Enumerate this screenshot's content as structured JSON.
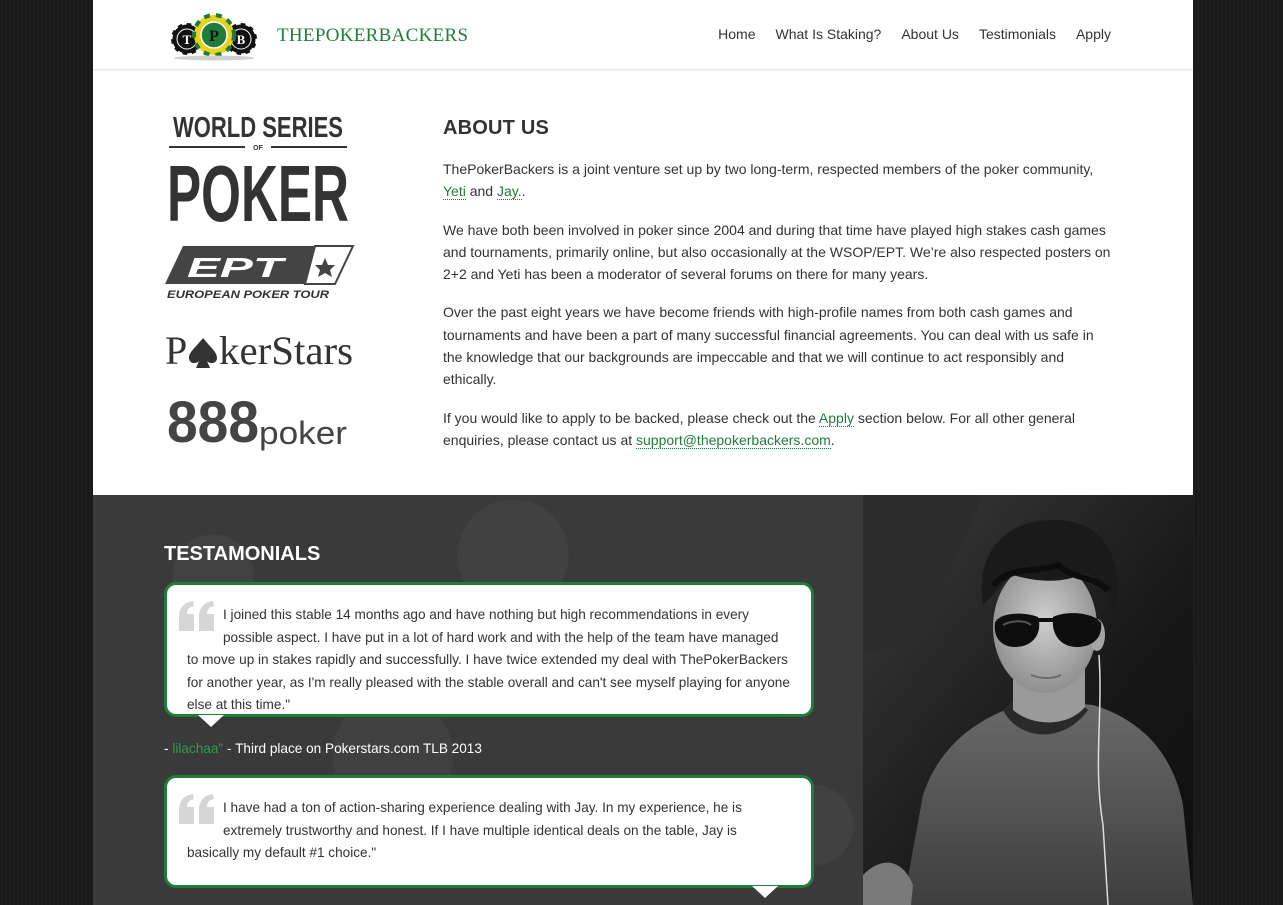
{
  "header": {
    "brand_part1": "THEPOKER",
    "brand_part2": "BACKERS",
    "logo_chip_letters": [
      "T",
      "P",
      "B"
    ],
    "nav": [
      {
        "label": "Home"
      },
      {
        "label": "What Is Staking?"
      },
      {
        "label": "About Us"
      },
      {
        "label": "Testimonials"
      },
      {
        "label": "Apply"
      }
    ]
  },
  "sponsors": {
    "wsop_line1": "WORLD SERIES",
    "wsop_of": "OF",
    "wsop_line2": "POKER",
    "ept_logo": "EPT",
    "ept_tagline": "EUROPEAN POKER TOUR",
    "pokerstars_left": "P",
    "pokerstars_right": "kerStars",
    "p888_num": "888",
    "p888_word": "poker"
  },
  "about": {
    "title": "ABOUT US",
    "p1_text": "ThePokerBackers is a joint venture set up by two long-term, respected members of the poker community, ",
    "p1_link1": "Yeti",
    "p1_and": " and ",
    "p1_link2": "Jay.",
    "p1_end": ".",
    "p2": "We have both been involved in poker since 2004 and during that time have played high stakes cash games and tournaments, primarily online, but also occasionally at the WSOP/EPT. We’re also respected posters on 2+2 and Yeti has been a moderator of several forums on there for many years.",
    "p3": "Over the past eight years we have become friends with high-profile names from both cash games and tournaments and have been a part of many successful financial agreements. You can deal with us safe in the knowledge that our backgrounds are impeccable and that we will continue to act responsibly and ethically.",
    "p4_text": "If you would like to apply to be backed, please check out the ",
    "p4_link": "Apply",
    "p4_mid": " section below. For all other general enquiries, please contact us at ",
    "p4_email": "support@thepokerbackers.com",
    "p4_end": "."
  },
  "testimonials": {
    "title": "TESTAMONIALS",
    "items": [
      {
        "quote": "I joined this stable 14 months ago and have nothing but high recommendations in every possible aspect. I have put in a lot of hard work and with the help of the team have managed to move up in stakes rapidly and successfully. I have twice extended my deal with ThePokerBackers for another year, as I'm really pleased with the stable overall and can't see myself playing for anyone else at this time.\"",
        "author_prefix": "- ",
        "author_name": "lilachaa\"",
        "author_desc": " - Third place on Pokerstars.com TLB 2013"
      },
      {
        "quote": "I have had a ton of action-sharing experience dealing with Jay. In my experience, he is extremely trustworthy and honest. If I have multiple identical deals on the table, Jay is basically my default #1 choice.\""
      }
    ]
  },
  "colors": {
    "brand_green": "#1f7d3b",
    "dark_bg": "#3a3a3a",
    "text": "#333333"
  }
}
